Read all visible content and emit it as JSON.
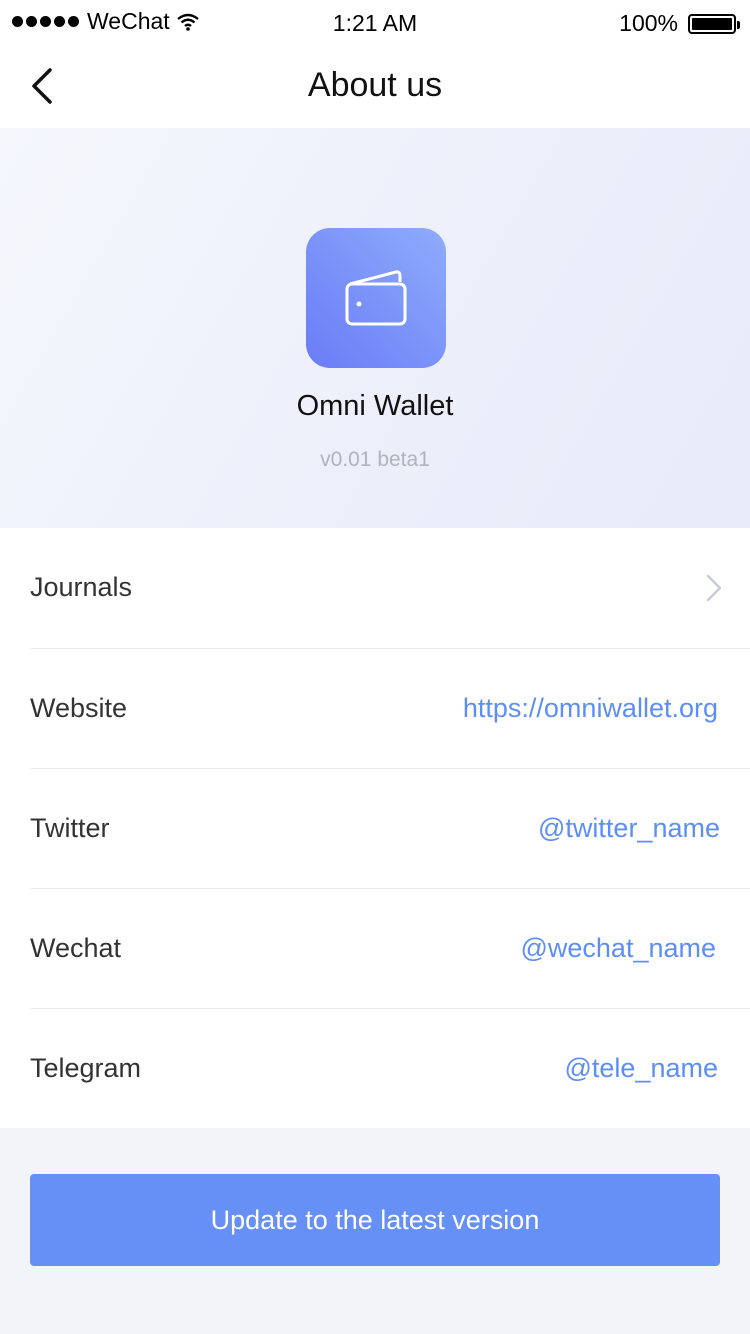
{
  "status_bar": {
    "carrier": "WeChat",
    "time": "1:21 AM",
    "battery_text": "100%",
    "battery_level": 1.0
  },
  "nav": {
    "title": "About us",
    "back_icon": "chevron-left-icon"
  },
  "app": {
    "name": "Omni Wallet",
    "version": "v0.01 beta1",
    "icon": "wallet-icon"
  },
  "list": [
    {
      "label": "Journals",
      "value": "",
      "icon": "chevron-right-icon"
    },
    {
      "label": "Website",
      "value": "https://omniwallet.org"
    },
    {
      "label": "Twitter",
      "value": "@twitter_name"
    },
    {
      "label": "Wechat",
      "value": "@wechat_name"
    },
    {
      "label": "Telegram",
      "value": "@tele_name"
    }
  ],
  "update_button": "Update to the latest version",
  "colors": {
    "accent": "#6690f6",
    "link": "#5d8ef5",
    "icon_gradient_start": "#6a7cf7",
    "icon_gradient_end": "#8eacfb"
  }
}
